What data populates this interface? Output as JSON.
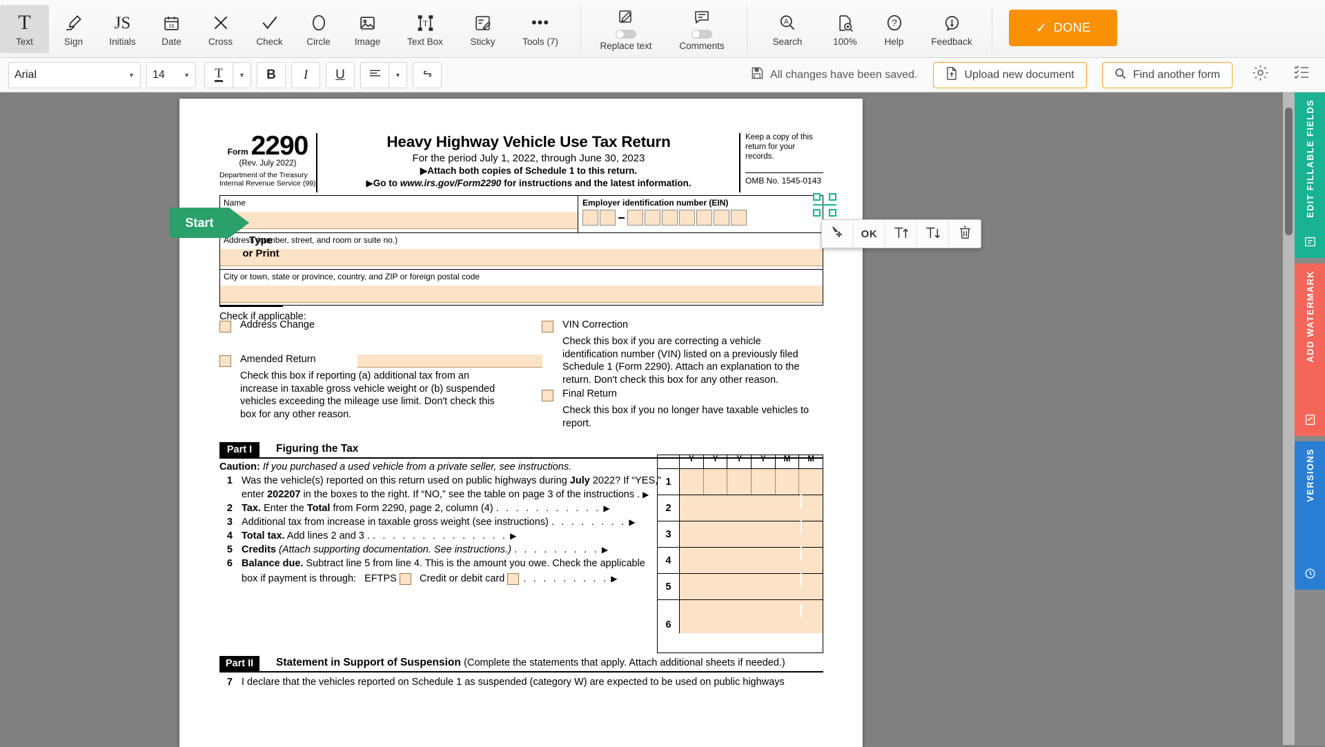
{
  "toolbar": {
    "tools": [
      {
        "name": "text",
        "label": "Text",
        "icon": "T",
        "active": true
      },
      {
        "name": "sign",
        "label": "Sign",
        "icon": "✒",
        "active": false
      },
      {
        "name": "initials",
        "label": "Initials",
        "icon": "JS",
        "active": false
      },
      {
        "name": "date",
        "label": "Date",
        "icon": "📅",
        "active": false
      },
      {
        "name": "cross",
        "label": "Cross",
        "icon": "✕",
        "active": false
      },
      {
        "name": "check",
        "label": "Check",
        "icon": "✓",
        "active": false
      },
      {
        "name": "circle",
        "label": "Circle",
        "icon": "◯",
        "active": false
      },
      {
        "name": "image",
        "label": "Image",
        "icon": "🖼",
        "active": false
      },
      {
        "name": "text-box",
        "label": "Text Box",
        "icon": "⊞",
        "active": false
      },
      {
        "name": "sticky",
        "label": "Sticky",
        "icon": "📝",
        "active": false
      },
      {
        "name": "tools",
        "label": "Tools (7)",
        "icon": "•••",
        "active": false
      }
    ],
    "toggles": [
      {
        "name": "replace-text",
        "label": "Replace text",
        "state": "off"
      },
      {
        "name": "comments",
        "label": "Comments",
        "state": "off"
      }
    ],
    "actions": [
      {
        "name": "search",
        "label": "Search",
        "icon": "search-icon"
      },
      {
        "name": "zoom",
        "label": "100%",
        "icon": "zoom-page-icon"
      },
      {
        "name": "help",
        "label": "Help",
        "icon": "question-icon"
      },
      {
        "name": "feedback",
        "label": "Feedback",
        "icon": "exclaim-bubble-icon"
      }
    ],
    "done_label": "DONE"
  },
  "format_bar": {
    "font_family": "Arial",
    "font_size": "14",
    "text_color_label": "T",
    "bold": "B",
    "italic": "I",
    "underline": "U",
    "align": "≡",
    "link": "🔗",
    "save_status": "All changes have been saved.",
    "upload_label": "Upload new document",
    "find_form_label": "Find another form",
    "settings_icon": "gear-icon",
    "list_icon": "checklist-icon"
  },
  "field_toolbar": {
    "buttons": [
      {
        "name": "move",
        "label": "✥",
        "icon": "move-cursor-icon"
      },
      {
        "name": "ok",
        "label": "OK",
        "icon": "ok-label"
      },
      {
        "name": "font-increase",
        "label": "T↑",
        "icon": "font-up-icon"
      },
      {
        "name": "font-decrease",
        "label": "T↓",
        "icon": "font-down-icon"
      },
      {
        "name": "delete",
        "label": "🗑",
        "icon": "trash-icon"
      }
    ]
  },
  "right_rail": [
    {
      "name": "edit-fillable-fields",
      "label": "EDIT FILLABLE FIELDS",
      "icon": "⎘",
      "color": "#19b394"
    },
    {
      "name": "add-watermark",
      "label": "ADD WATERMARK",
      "icon": "⎙",
      "color": "#f4655a"
    },
    {
      "name": "versions",
      "label": "VERSIONS",
      "icon": "🕘",
      "color": "#2a7fd4"
    }
  ],
  "document": {
    "start_flag": "Start",
    "type_or_print": "Type\nor Print",
    "header": {
      "form_word": "Form",
      "form_number": "2290",
      "revision": "(Rev. July 2022)",
      "department": "Department of the Treasury\nInternal Revenue Service (99)",
      "title": "Heavy Highway Vehicle Use Tax Return",
      "period": "For the period July 1, 2022, through June 30, 2023",
      "attach_line": "Attach both copies of Schedule 1 to this return.",
      "goto_line_pre": "Go to ",
      "goto_line_url": "www.irs.gov/Form2290",
      "goto_line_post": " for instructions and the latest information.",
      "keep_copy": "Keep a copy of this return for your records.",
      "omb": "OMB No. 1545-0143"
    },
    "entity": {
      "name_label": "Name",
      "ein_label": "Employer identification number (EIN)",
      "address_label": "Address (number, street, and room or suite no.)",
      "city_label": "City or town, state or province, country, and ZIP or foreign postal code"
    },
    "check_applicable_label": "Check if applicable:",
    "checkboxes": [
      {
        "name": "address-change",
        "label": "Address Change",
        "note": ""
      },
      {
        "name": "amended-return",
        "label": "Amended Return",
        "note": "Check this box if reporting (a) additional tax from an increase in taxable gross vehicle weight or (b) suspended vehicles exceeding the mileage use limit. Don't check this box for any other reason."
      },
      {
        "name": "vin-correction",
        "label": "VIN Correction",
        "note": "Check this box if you are correcting a vehicle identification number (VIN) listed on a previously filed Schedule 1 (Form 2290). Attach an explanation to the return. Don't check this box for any other reason."
      },
      {
        "name": "final-return",
        "label": "Final Return",
        "note": "Check this box if you no longer have taxable vehicles to report."
      }
    ],
    "part1": {
      "tag": "Part I",
      "title": "Figuring the Tax",
      "caution_bold": "Caution:",
      "caution_text": "If you purchased a used vehicle from a private seller, see instructions.",
      "column_headers": [
        "Y",
        "Y",
        "Y",
        "Y",
        "M",
        "M"
      ],
      "lines": [
        {
          "no": "1",
          "text_a": "Was the vehicle(s) reported on this return used on public highways during ",
          "bold_a": "July",
          "text_b": " 2022? If “YES,”",
          "text_c": "enter ",
          "bold_b": "202207",
          "text_d": " in the boxes to the right. If “NO,” see the table on page 3 of the instructions .",
          "arrow": "▶"
        },
        {
          "no": "2",
          "bold": "Tax.",
          "text": " Enter the ",
          "bold2": "Total",
          "text2": " from Form 2290, page 2, column (4)",
          "dots": ". . . . . . . . . . .",
          "arrow": "▶"
        },
        {
          "no": "3",
          "text": "Additional tax from increase in taxable gross weight (see instructions)",
          "dots": ". . . . . . . .",
          "arrow": "▶"
        },
        {
          "no": "4",
          "bold": "Total tax.",
          "text": " Add lines 2 and 3 .",
          "dots": ". . . . . . . . . . . . . .",
          "arrow": "▶"
        },
        {
          "no": "5",
          "bold": "Credits",
          "text": " (Attach supporting documentation. See instructions.)",
          "dots": ". . . . . . . . .",
          "arrow": "▶"
        },
        {
          "no": "6",
          "bold": "Balance due.",
          "text": " Subtract line 5 from line 4. This is the amount you owe. Check the applicable",
          "text2": "box if payment is through:   EFTPS ",
          "text3": "   Credit or debit card ",
          "dots": ". . . . . . . . .",
          "arrow": "▶"
        }
      ]
    },
    "part2": {
      "tag": "Part II",
      "title": "Statement in Support of Suspension",
      "subtitle": "(Complete the statements that apply. Attach additional sheets if needed.)",
      "line7_no": "7",
      "line7_text": "I declare that the vehicles reported on Schedule 1 as suspended (category W) are expected to be used on public highways"
    }
  },
  "colors": {
    "accent_orange": "#fa9005",
    "field_fill": "#fce3c7",
    "rail_green": "#19b394",
    "rail_red": "#f4655a",
    "rail_blue": "#2a7fd4",
    "start_green": "#2aa06a"
  }
}
